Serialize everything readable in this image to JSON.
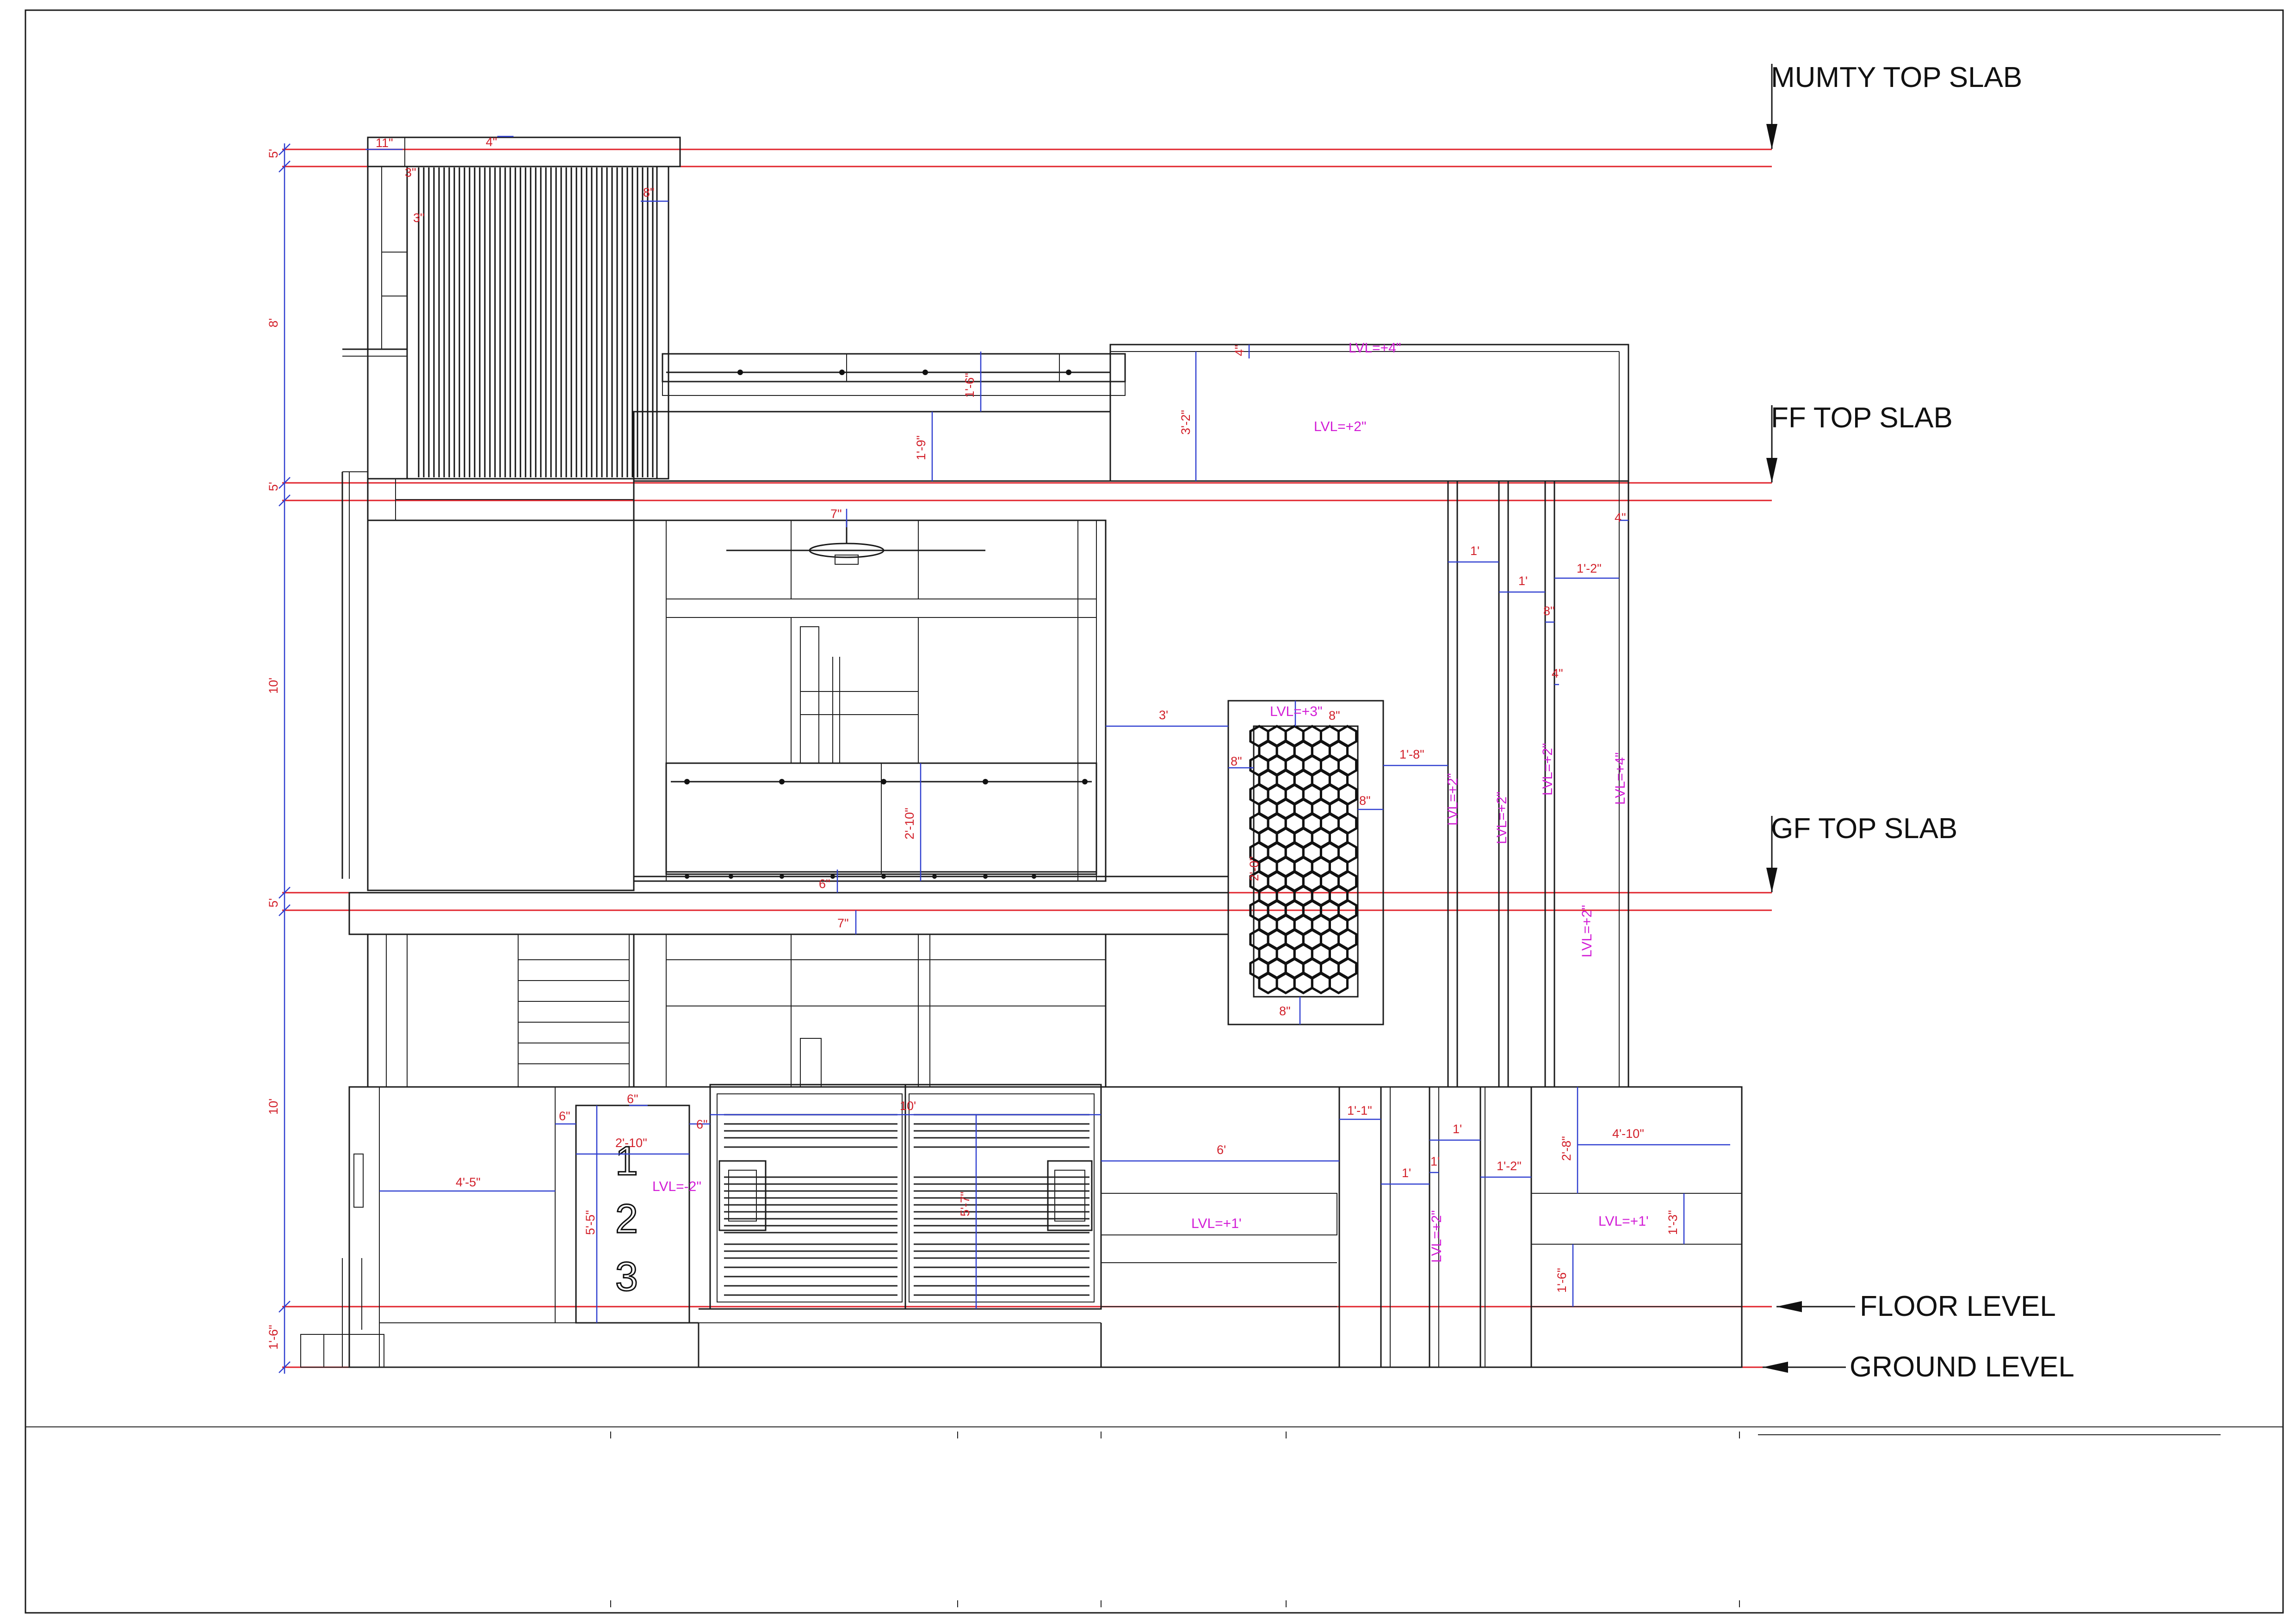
{
  "levels": [
    {
      "label": "MUMTY TOP SLAB"
    },
    {
      "label": "FF TOP SLAB"
    },
    {
      "label": "GF TOP SLAB"
    },
    {
      "label": "FLOOR LEVEL"
    },
    {
      "label": "GROUND LEVEL"
    }
  ],
  "vertical_dims": [
    "5'",
    "8'",
    "5'",
    "10'",
    "5'",
    "10'",
    "1'-6\""
  ],
  "dims": [
    "11\"",
    "4\"",
    "3\"",
    "3\"",
    "8\"",
    "1'-6\"",
    "1'-9\"",
    "3'-2\"",
    "4\"",
    "7\"",
    "1'",
    "1'",
    "1'-2\"",
    "8\"",
    "4\"",
    "4\"",
    "3'",
    "1'-8\"",
    "8\"",
    "8\"",
    "8\"",
    "2'-10\"",
    "6\"",
    "7\"",
    "8\"",
    "6\"",
    "6\"",
    "6\"",
    "2'-10\"",
    "10'",
    "4'-5\"",
    "5'-5\"",
    "5'-7\"",
    "6'",
    "1'-1\"",
    "1'",
    "1'",
    "1'-2\"",
    "2'-8\"",
    "4'-10\"",
    "1'",
    "1'-3\"",
    "1'-6\"",
    "2'-0\""
  ],
  "level_texts": [
    "LVL=+4\"",
    "LVL=+2\"",
    "LVL=+3\"",
    "LVL=+2\"",
    "LVL=-2\"",
    "LVL=+1'",
    "LVL=+1'",
    "LVL=+2\"",
    "LVL=+2\"",
    "LVL=+2\"",
    "LVL=+4\"",
    "LVL=+2\"",
    "LVL=+2\""
  ],
  "steps": [
    "1",
    "2",
    "3"
  ],
  "colors": {
    "linework": "#1a1a1a",
    "level_line": "#e0232b",
    "dimension_line": "#2f3fd0",
    "dimension_text": "#d2202a",
    "level_text": "#d21cd6"
  }
}
